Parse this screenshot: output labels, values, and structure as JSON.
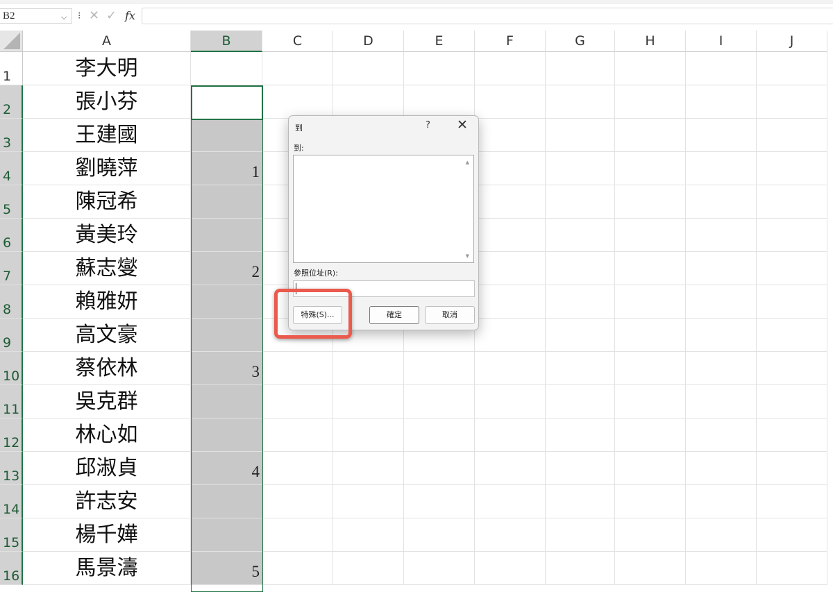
{
  "formula_bar": {
    "name_box": "B2",
    "dots": "⁝",
    "cancel": "✕",
    "enter": "✓",
    "fx": "fx",
    "formula": ""
  },
  "columns": [
    "A",
    "B",
    "C",
    "D",
    "E",
    "F",
    "G",
    "H",
    "I",
    "J"
  ],
  "rows": [
    "1",
    "2",
    "3",
    "4",
    "5",
    "6",
    "7",
    "8",
    "9",
    "10",
    "11",
    "12",
    "13",
    "14",
    "15",
    "16"
  ],
  "names": [
    "李大明",
    "張小芬",
    "王建國",
    "劉曉萍",
    "陳冠希",
    "黃美玲",
    "蘇志燮",
    "賴雅妍",
    "高文豪",
    "蔡依林",
    "吳克群",
    "林心如",
    "邱淑貞",
    "許志安",
    "楊千嬅",
    "馬景濤"
  ],
  "b_values": [
    "",
    "",
    "",
    "1",
    "",
    "",
    "2",
    "",
    "",
    "3",
    "",
    "",
    "4",
    "",
    "",
    "5"
  ],
  "dialog": {
    "title": "到",
    "help": "?",
    "close": "✕",
    "list_label": "到:",
    "reference_label": "參照位址(R):",
    "reference_value": "",
    "special_button": "特殊(S)...",
    "ok_button": "確定",
    "cancel_button": "取消",
    "scroll_up": "▲",
    "scroll_down": "▼"
  },
  "colors": {
    "accent_green": "#217346",
    "highlight_red": "#ea5a4d",
    "selection_gray": "#c8c8c8"
  }
}
